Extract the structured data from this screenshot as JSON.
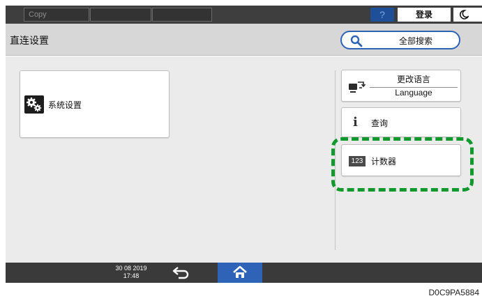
{
  "status_bar": {
    "slot1_label": "Copy",
    "slot2_label": "",
    "slot3_label": "",
    "help_label": "?",
    "login_label": "登录"
  },
  "title_bar": {
    "title": "直连设置",
    "search_label": "全部搜索"
  },
  "main": {
    "tiles": [
      {
        "label": "系统设置",
        "icon": "gears-icon"
      }
    ]
  },
  "side": {
    "language": {
      "top_label": "更改语言",
      "bottom_label": "Language",
      "icon": "language-switch-icon"
    },
    "inquiry": {
      "label": "查询",
      "icon": "info-icon",
      "icon_glyph": "i"
    },
    "counter": {
      "label": "计数器",
      "icon": "counter-icon",
      "icon_glyph": "123"
    }
  },
  "bottom_bar": {
    "date": "30 08 2019",
    "time": "17:48"
  },
  "reference_code": "D0C9PA5884",
  "colors": {
    "accent_blue": "#2e63b8",
    "highlight_green": "#109a2e",
    "status_bar": "#3e3e3e",
    "title_bar": "#d7d7d7"
  }
}
